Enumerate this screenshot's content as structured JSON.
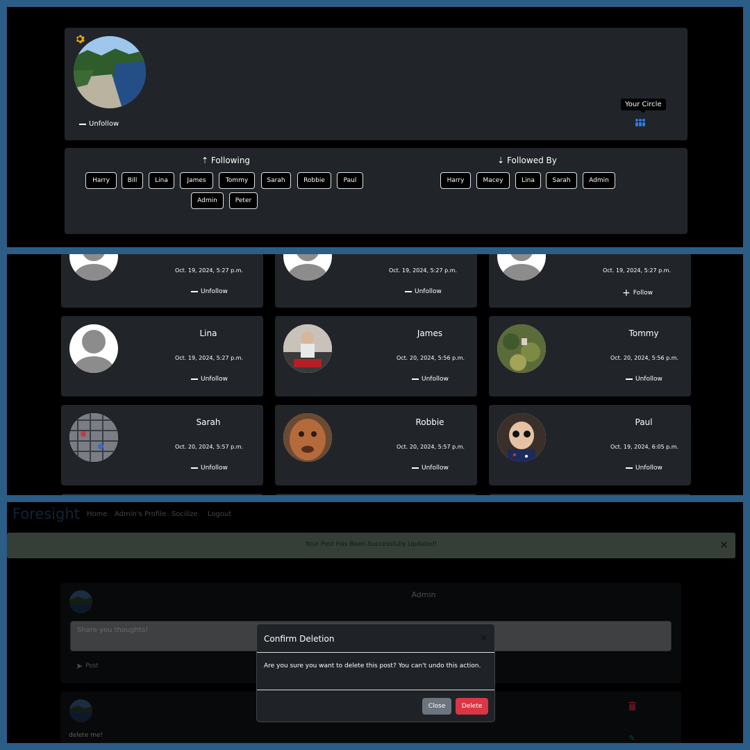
{
  "profile": {
    "unfollow_label": "Unfollow",
    "tooltip": "Your Circle",
    "following_title": "Following",
    "followed_by_title": "Followed By",
    "following": [
      "Harry",
      "Bill",
      "Lina",
      "James",
      "Tommy",
      "Sarah",
      "Robbie",
      "Paul",
      "Admin",
      "Peter"
    ],
    "followed_by": [
      "Harry",
      "Macey",
      "Lina",
      "Sarah",
      "Admin"
    ],
    "icons": {
      "settings": "gear-icon",
      "circle": "people-group-icon"
    },
    "colors": {
      "gear": "#f2a900",
      "circle_icon": "#2f7be5"
    }
  },
  "users": {
    "top_row": [
      {
        "date": "Oct. 19, 2024, 5:27 p.m.",
        "action": "Unfollow"
      },
      {
        "date": "Oct. 19, 2024, 5:27 p.m.",
        "action": "Unfollow"
      },
      {
        "date": "Oct. 19, 2024, 5:27 p.m.",
        "action": "Follow"
      }
    ],
    "cards": [
      {
        "name": "Lina",
        "date": "Oct. 19, 2024, 5:27 p.m.",
        "action": "Unfollow"
      },
      {
        "name": "James",
        "date": "Oct. 20, 2024, 5:56 p.m.",
        "action": "Unfollow"
      },
      {
        "name": "Tommy",
        "date": "Oct. 20, 2024, 5:56 p.m.",
        "action": "Unfollow"
      },
      {
        "name": "Sarah",
        "date": "Oct. 20, 2024, 5:57 p.m.",
        "action": "Unfollow"
      },
      {
        "name": "Robbie",
        "date": "Oct. 20, 2024, 5:57 p.m.",
        "action": "Unfollow"
      },
      {
        "name": "Paul",
        "date": "Oct. 19, 2024, 6:05 p.m.",
        "action": "Unfollow"
      }
    ]
  },
  "feed": {
    "brand": "Foresight",
    "nav": [
      "Home",
      "Admin's Profile",
      "Socilize",
      "Logout"
    ],
    "alert": "Your Post Has Been Successfully Updated!",
    "composer_user": "Admin",
    "placeholder": "Share you thoughts!",
    "post_button": "Post",
    "post_text": "delete me!",
    "modal": {
      "title": "Confirm Deletion",
      "body": "Are you sure you want to delete this post? You can't undo this action.",
      "close": "Close",
      "delete": "Delete"
    },
    "colors": {
      "brand": "#25466a",
      "alert_bg": "#6b7c6f",
      "delete": "#dc3545",
      "close": "#6c757d",
      "trash": "#b02a37",
      "edit": "#198754"
    }
  }
}
